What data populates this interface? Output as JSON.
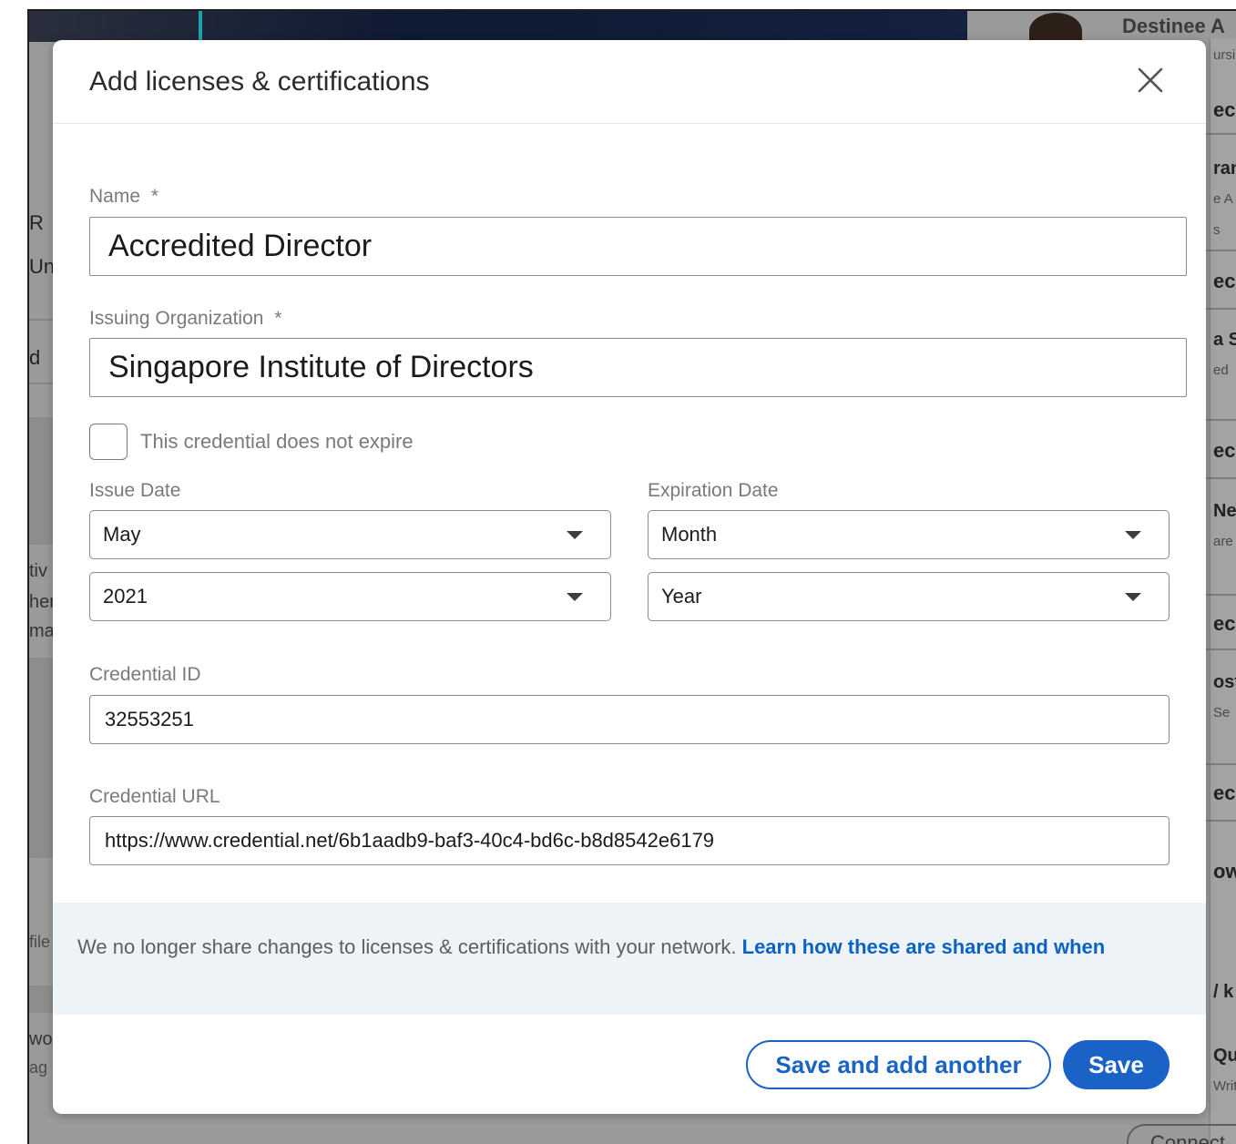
{
  "background": {
    "top_right_name": "Destinee A",
    "top_right_sub": "ursi",
    "fragments_right": [
      "ec",
      "ran",
      "e A",
      "s",
      "ec",
      "a S",
      "ed",
      "ec",
      "Nes",
      "are",
      "ec",
      "ost",
      "Se",
      "ec",
      "ow",
      "/ k",
      "Qu",
      "Writ"
    ],
    "fragments_left": [
      "R",
      "Un",
      "d",
      "tiv",
      "her",
      "ma",
      "file",
      "wo",
      "ag"
    ],
    "connect_label": "Connect"
  },
  "modal": {
    "title": "Add licenses & certifications",
    "close_icon": "close-icon",
    "fields": {
      "name_label": "Name",
      "name_required": "*",
      "name_value": "Accredited Director",
      "org_label": "Issuing Organization",
      "org_required": "*",
      "org_value": "Singapore Institute of Directors",
      "no_expire_label": "This credential does not expire",
      "issue_date_label": "Issue Date",
      "issue_month": "May",
      "issue_year": "2021",
      "expiration_date_label": "Expiration Date",
      "expiration_month": "Month",
      "expiration_year": "Year",
      "credential_id_label": "Credential ID",
      "credential_id_value": "32553251",
      "credential_url_label": "Credential URL",
      "credential_url_value": "https://www.credential.net/6b1aadb9-baf3-40c4-bd6c-b8d8542e6179"
    },
    "notice": {
      "text": "We no longer share changes to licenses & certifications with your network. ",
      "link": "Learn how these are shared and when"
    },
    "buttons": {
      "save_and_add": "Save and add another",
      "save": "Save"
    },
    "colors": {
      "primary": "#1b62c6",
      "link": "#0a62c2",
      "notice_bg": "#eef3f8"
    }
  }
}
